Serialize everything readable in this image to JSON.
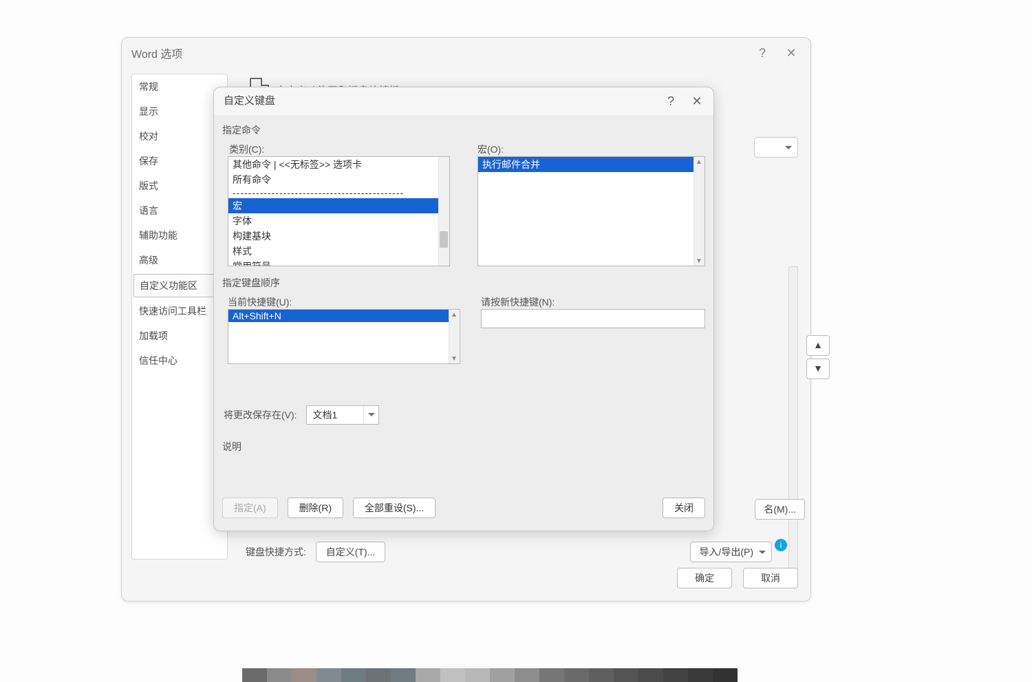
{
  "outer": {
    "title": "Word 选项",
    "sidebar": {
      "items": [
        {
          "label": "常规"
        },
        {
          "label": "显示"
        },
        {
          "label": "校对"
        },
        {
          "label": "保存"
        },
        {
          "label": "版式"
        },
        {
          "label": "语言"
        },
        {
          "label": "辅助功能"
        },
        {
          "label": "高级"
        },
        {
          "label": "自定义功能区",
          "selected": true
        },
        {
          "label": "快速访问工具栏"
        },
        {
          "label": "加载项"
        },
        {
          "label": "信任中心"
        }
      ]
    },
    "content": {
      "heading": "自定义功能区和键盘快捷键",
      "rename_btn": "名(M)...",
      "import_export_btn": "导入/导出(P)",
      "kb_label": "键盘快捷方式:",
      "kb_btn": "自定义(T)..."
    },
    "footer": {
      "ok": "确定",
      "cancel": "取消"
    }
  },
  "inner": {
    "title": "自定义键盘",
    "sections": {
      "command": "指定命令",
      "sequence": "指定键盘顺序",
      "description": "说明"
    },
    "labels": {
      "category": "类别(C):",
      "macro": "宏(O):",
      "current_keys": "当前快捷键(U):",
      "new_key": "请按新快捷键(N):",
      "save_in": "将更改保存在(V):"
    },
    "categories": [
      "其他命令 | <<无标签>> 选项卡",
      "所有命令",
      "---",
      "宏",
      "字体",
      "构建基块",
      "样式",
      "常用符号"
    ],
    "category_selected": "宏",
    "macros": [
      "执行邮件合并"
    ],
    "macro_selected": "执行邮件合并",
    "current_keys": [
      "Alt+Shift+N"
    ],
    "current_key_selected": "Alt+Shift+N",
    "new_key_value": "",
    "save_in_value": "文档1",
    "buttons": {
      "assign": "指定(A)",
      "remove": "删除(R)",
      "reset_all": "全部重设(S)...",
      "close": "关闭"
    }
  },
  "swatches": [
    "#6b6b6b",
    "#8a8a8a",
    "#9b8c86",
    "#808a90",
    "#6f7b82",
    "#6d7276",
    "#707c7f",
    "#a9a9a9",
    "#c0c0c0",
    "#b8b8b8",
    "#a0a0a0",
    "#8d8d8d",
    "#767676",
    "#6a6a6a",
    "#5f5f5f",
    "#545454",
    "#4b4b4b",
    "#424242",
    "#3a3a3a",
    "#323232"
  ]
}
